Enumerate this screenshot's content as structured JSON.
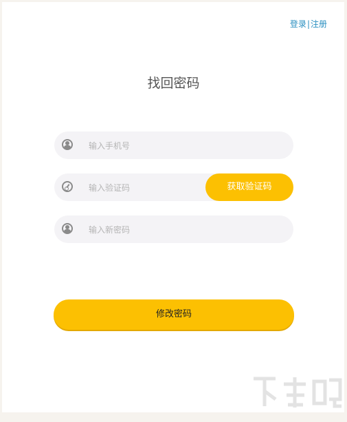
{
  "header": {
    "login_label": "登录",
    "separator": "|",
    "register_label": "注册"
  },
  "page": {
    "title": "找回密码"
  },
  "form": {
    "phone_placeholder": "输入手机号",
    "code_placeholder": "输入验证码",
    "get_code_label": "获取验证码",
    "new_password_placeholder": "输入新密码",
    "submit_label": "修改密码"
  },
  "colors": {
    "accent": "#fcc002",
    "link": "#2a8fc0",
    "input_bg": "#f4f3f6"
  },
  "icons": {
    "phone": "user-icon",
    "code": "key-icon",
    "password": "user-icon"
  }
}
